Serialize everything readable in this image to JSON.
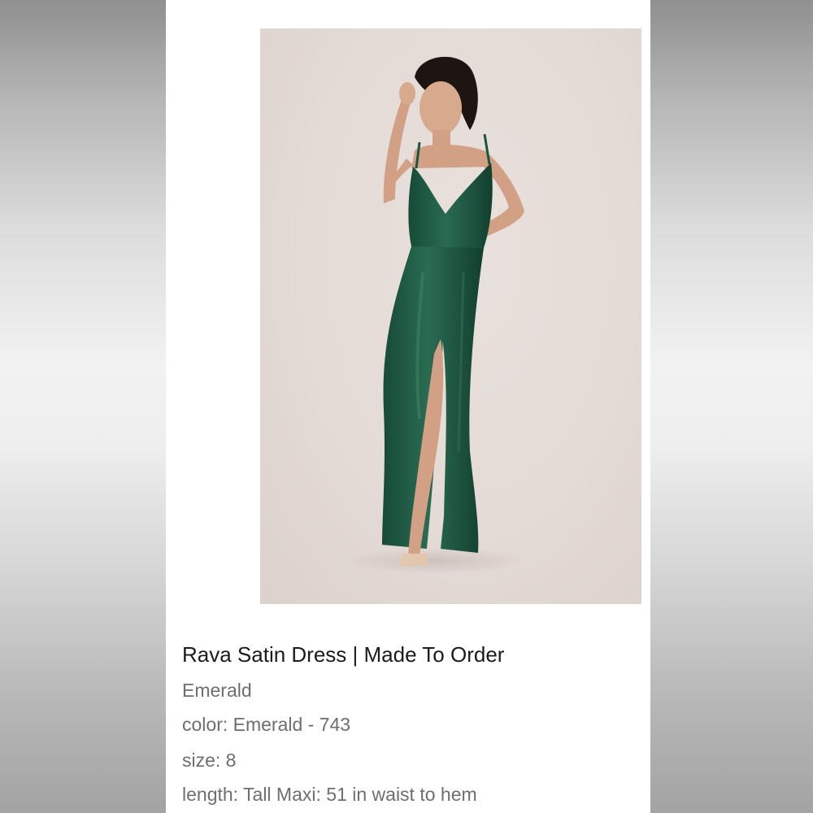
{
  "product": {
    "title": "Rava Satin Dress | Made To Order",
    "variant": "Emerald",
    "color_line": "color: Emerald - 743",
    "size_line": "size: 8",
    "length_line": "length: Tall Maxi: 51 in waist to hem"
  },
  "colors": {
    "dress": "#1e5a44",
    "backdrop": "#e6ddd9",
    "card": "#ffffff"
  }
}
